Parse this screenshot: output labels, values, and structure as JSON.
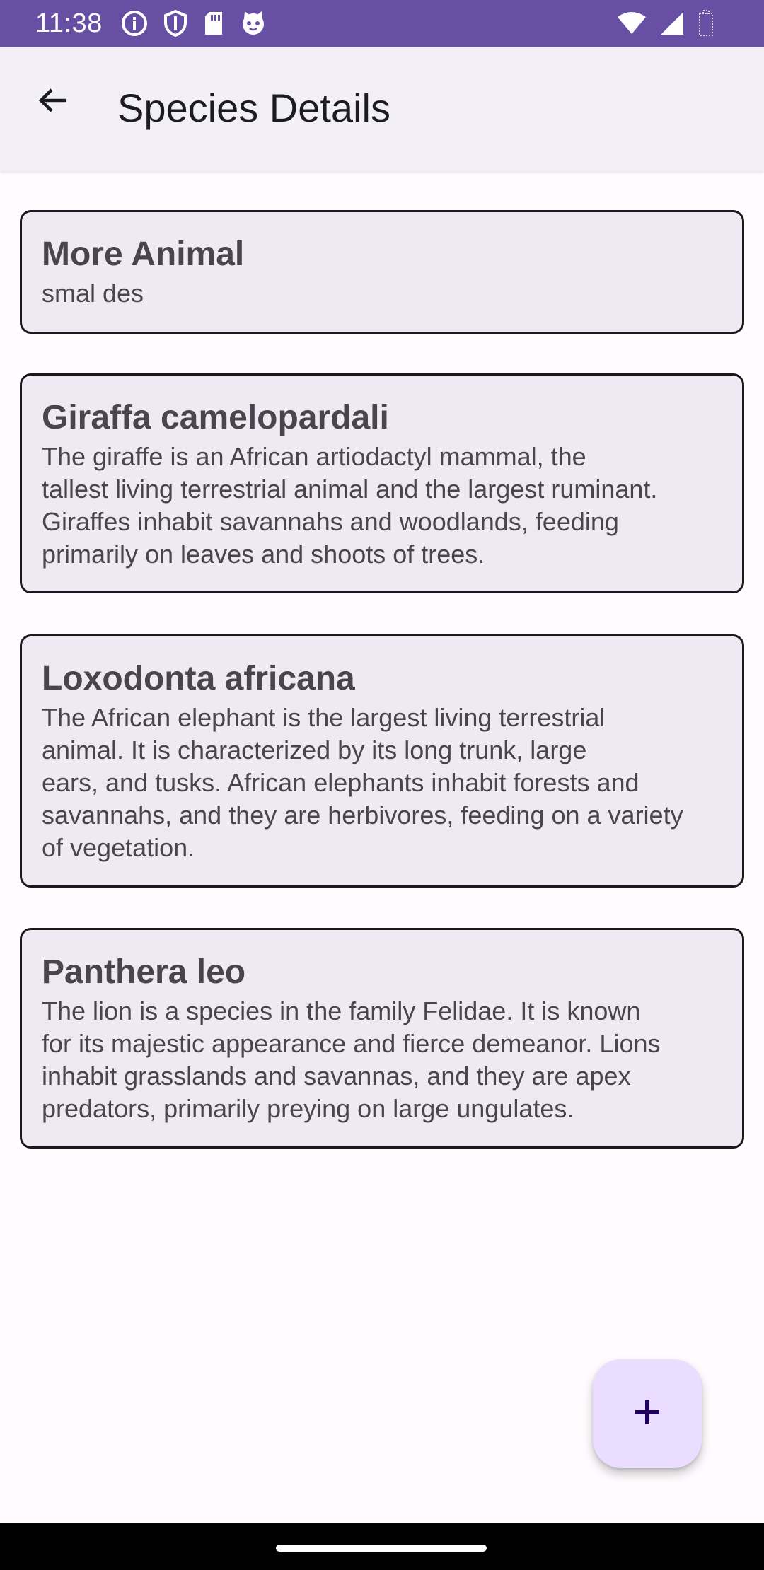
{
  "status_bar": {
    "time": "11:38",
    "left_icons": [
      "info-icon",
      "shield-icon",
      "sd-card-icon",
      "cat-icon"
    ],
    "right_icons": [
      "wifi-icon",
      "signal-icon",
      "battery-icon"
    ],
    "background": "#6750a4"
  },
  "app_bar": {
    "back_icon": "arrow-back-icon",
    "title": "Species Details"
  },
  "species": [
    {
      "name": "More Animal",
      "description": "smal des"
    },
    {
      "name": "Giraffa camelopardali",
      "description": "The giraffe is an African artiodactyl mammal, the\ntallest living terrestrial animal and the largest ruminant.\nGiraffes inhabit savannahs and woodlands, feeding\nprimarily on leaves and shoots of trees."
    },
    {
      "name": "Loxodonta africana",
      "description": "The African elephant is the largest living terrestrial\nanimal. It is characterized by its long trunk, large\nears, and tusks. African elephants inhabit forests and\nsavannahs, and they are herbivores, feeding on a variety\nof vegetation."
    },
    {
      "name": "Panthera leo",
      "description": "The lion is a species in the family Felidae. It is known\nfor its majestic appearance and fierce demeanor. Lions\ninhabit grasslands and savannas, and they are apex\npredators, primarily preying on large ungulates."
    }
  ],
  "fab": {
    "icon": "plus-icon",
    "color": "#eaddff"
  }
}
